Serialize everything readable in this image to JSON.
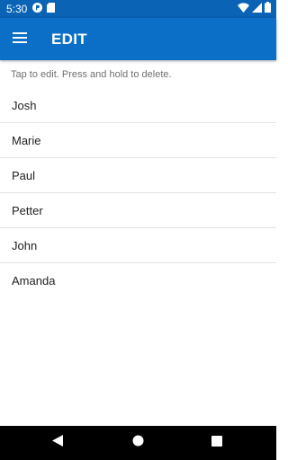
{
  "status_bar": {
    "time": "5:30",
    "left_icons": [
      "notification-p-icon",
      "sd-card-icon"
    ],
    "right_icons": [
      "wifi-icon",
      "signal-icon",
      "battery-icon"
    ]
  },
  "app_bar": {
    "title": "EDIT",
    "menu_icon": "hamburger-menu-icon",
    "color": "#0b6fc7"
  },
  "hint": "Tap to edit. Press and hold to delete.",
  "list": {
    "items": [
      "Josh",
      "Marie",
      "Paul",
      "Petter",
      "John",
      "Amanda"
    ]
  },
  "nav_bar": {
    "buttons": [
      "back-icon",
      "home-icon",
      "recents-icon"
    ]
  }
}
